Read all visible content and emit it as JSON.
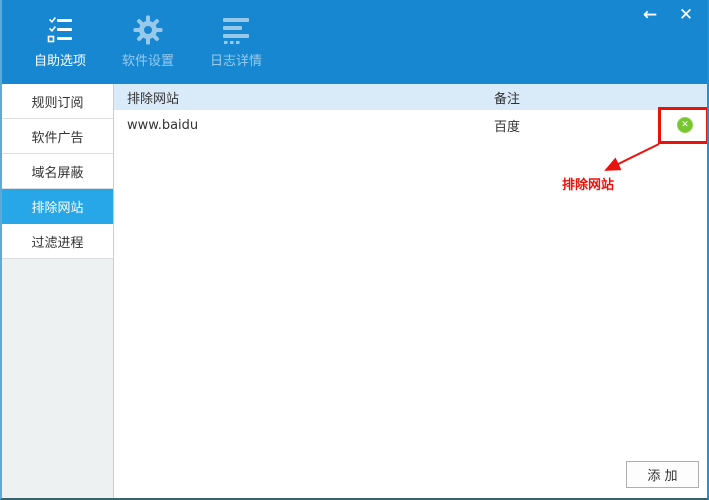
{
  "window": {
    "controls": {
      "back": "←",
      "close": "✕"
    }
  },
  "header": {
    "tabs": [
      {
        "label": "自助选项",
        "icon": "checklist-icon",
        "active": true
      },
      {
        "label": "软件设置",
        "icon": "gear-icon",
        "active": false
      },
      {
        "label": "日志详情",
        "icon": "log-list-icon",
        "active": false
      }
    ]
  },
  "sidebar": {
    "items": [
      {
        "label": "规则订阅",
        "active": false
      },
      {
        "label": "软件广告",
        "active": false
      },
      {
        "label": "域名屏蔽",
        "active": false
      },
      {
        "label": "排除网站",
        "active": true
      },
      {
        "label": "过滤进程",
        "active": false
      }
    ]
  },
  "main": {
    "table": {
      "columns": [
        "排除网站",
        "备注"
      ],
      "rows": [
        {
          "site": "www.baidu",
          "note": "百度",
          "delete_icon": "circle-x-icon"
        }
      ]
    },
    "annotation": {
      "label": "排除网站",
      "color": "#e8130c"
    },
    "add_button_label": "添 加"
  },
  "colors": {
    "header_blue": "#1787d2",
    "selected_item_blue": "#28a7e8",
    "table_header_bg": "#d9eaf8",
    "delete_green": "#78c62f",
    "annotation_red": "#e8130c",
    "sidebar_bg": "#eef1f2"
  }
}
